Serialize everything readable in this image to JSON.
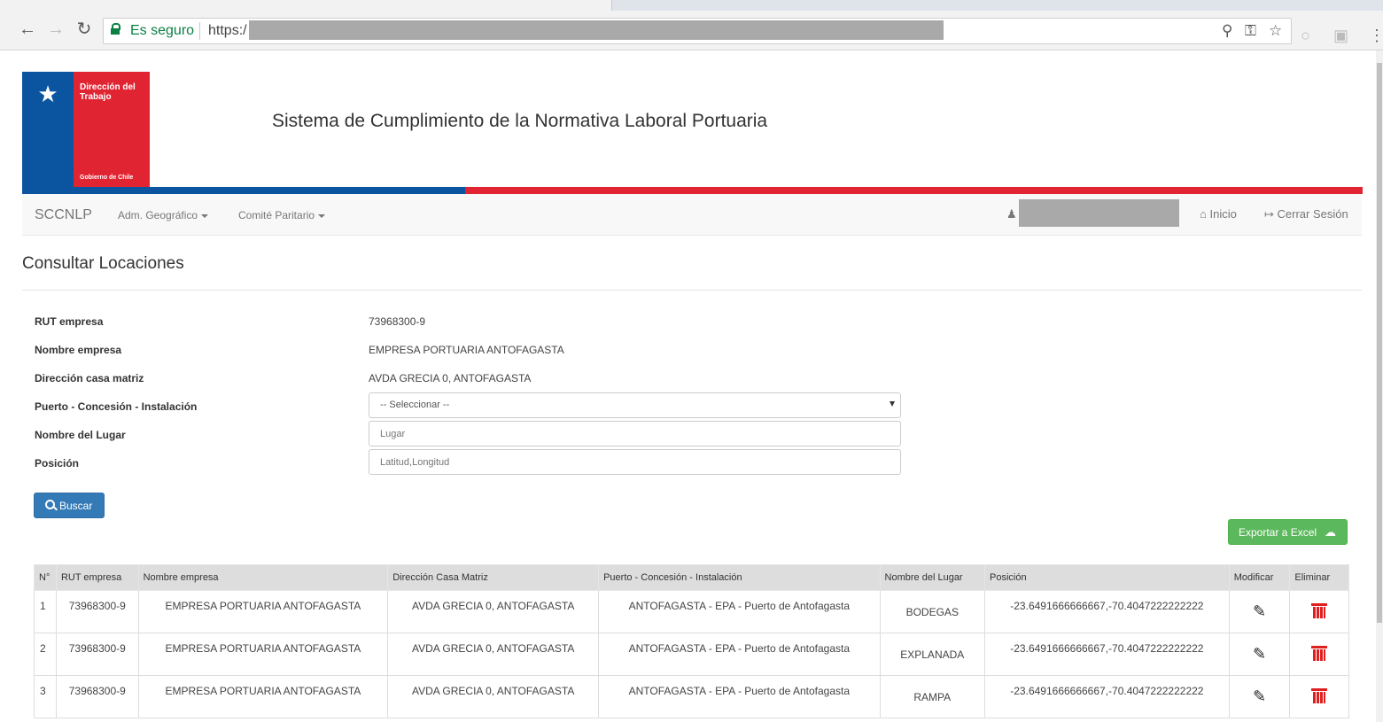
{
  "browser": {
    "secure_label": "Es seguro",
    "url_prefix": "https:/",
    "icons": [
      "back-icon",
      "forward-icon",
      "reload-icon",
      "zoom-icon",
      "key-icon",
      "star-icon",
      "extension-icon",
      "pdf-icon",
      "menu-icon"
    ]
  },
  "header": {
    "org_name": "Dirección del Trabajo",
    "gov_name": "Gobierno de Chile",
    "system_title": "Sistema de Cumplimiento de la Normativa Laboral Portuaria",
    "colors": {
      "blue": "#0b55a0",
      "red": "#e02432"
    }
  },
  "navbar": {
    "brand": "SCCNLP",
    "menus": [
      "Adm. Geográfico",
      "Comité Paritario"
    ],
    "inicio": "Inicio",
    "logout": "Cerrar Sesión"
  },
  "page": {
    "title": "Consultar Locaciones"
  },
  "form": {
    "rut_label": "RUT empresa",
    "rut_value": "73968300-9",
    "nombre_label": "Nombre empresa",
    "nombre_value": "EMPRESA PORTUARIA ANTOFAGASTA",
    "direccion_label": "Dirección casa matriz",
    "direccion_value": "AVDA GRECIA 0, ANTOFAGASTA",
    "puerto_label": "Puerto - Concesión - Instalación",
    "puerto_selected": "-- Seleccionar --",
    "lugar_label": "Nombre del Lugar",
    "lugar_placeholder": "Lugar",
    "posicion_label": "Posición",
    "posicion_placeholder": "Latitud,Longitud",
    "buscar_label": "Buscar"
  },
  "actions": {
    "export_label": "Exportar a Excel"
  },
  "table": {
    "headers": [
      "N°",
      "RUT empresa",
      "Nombre empresa",
      "Dirección Casa Matriz",
      "Puerto - Concesión - Instalación",
      "Nombre del Lugar",
      "Posición",
      "Modificar",
      "Eliminar"
    ],
    "rows": [
      {
        "n": "1",
        "rut": "73968300-9",
        "nombre": "EMPRESA PORTUARIA ANTOFAGASTA",
        "direccion": "AVDA GRECIA 0, ANTOFAGASTA",
        "puerto": "ANTOFAGASTA - EPA - Puerto de Antofagasta",
        "lugar": "BODEGAS",
        "posicion": "-23.6491666666667,-70.4047222222222"
      },
      {
        "n": "2",
        "rut": "73968300-9",
        "nombre": "EMPRESA PORTUARIA ANTOFAGASTA",
        "direccion": "AVDA GRECIA 0, ANTOFAGASTA",
        "puerto": "ANTOFAGASTA - EPA - Puerto de Antofagasta",
        "lugar": "EXPLANADA",
        "posicion": "-23.6491666666667,-70.4047222222222"
      },
      {
        "n": "3",
        "rut": "73968300-9",
        "nombre": "EMPRESA PORTUARIA ANTOFAGASTA",
        "direccion": "AVDA GRECIA 0, ANTOFAGASTA",
        "puerto": "ANTOFAGASTA - EPA - Puerto de Antofagasta",
        "lugar": "RAMPA",
        "posicion": "-23.6491666666667,-70.4047222222222"
      }
    ]
  }
}
